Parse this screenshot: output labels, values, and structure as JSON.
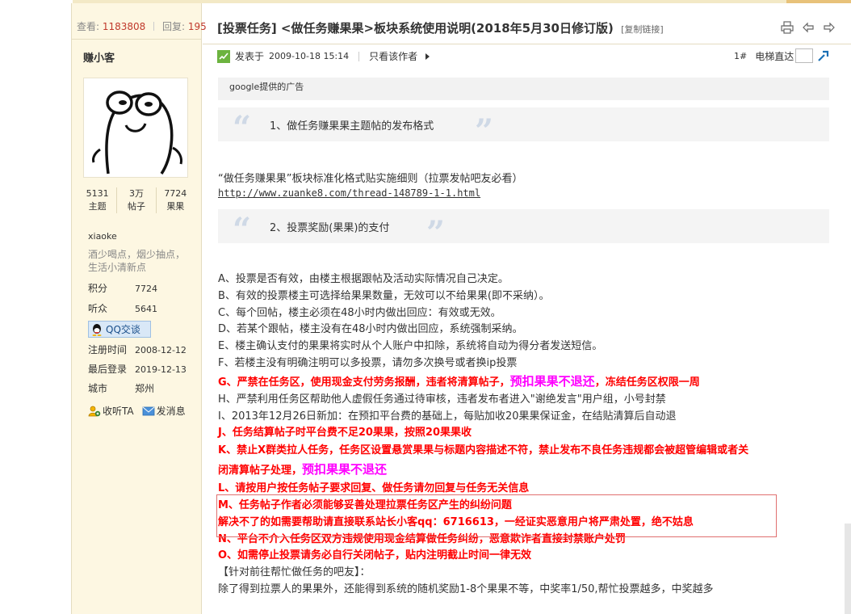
{
  "sidebar": {
    "stats_view_label": "查看:",
    "stats_view_value": "1183808",
    "stats_reply_label": "回复:",
    "stats_reply_value": "195",
    "username": "赚小客",
    "counts": [
      {
        "value": "5131",
        "label": "主题"
      },
      {
        "value": "3万",
        "label": "帖子"
      },
      {
        "value": "7724",
        "label": "果果"
      }
    ],
    "uid": "xiaoke",
    "signature": "酒少喝点，烟少抽点，生活小清新点",
    "fields": [
      {
        "label": "积分",
        "value": "7724"
      },
      {
        "label": "听众",
        "value": "5641"
      }
    ],
    "qq_button": "QQ交谈",
    "fields2": [
      {
        "label": "注册时间",
        "value": "2008-12-12"
      },
      {
        "label": "最后登录",
        "value": "2019-12-13"
      },
      {
        "label": "城市",
        "value": "郑州"
      }
    ],
    "listen_ta": "收听TA",
    "send_message": "发消息"
  },
  "post": {
    "title": "[投票任务] <做任务赚果果>板块系统使用说明(2018年5月30日修订版)",
    "copy_link": "[复制链接]",
    "posted_label": "发表于",
    "posted_time": "2009-10-18 15:14",
    "author_only": "只看该作者",
    "floor": "1#",
    "jump_label": "电梯直达",
    "ad_text": "google提供的广告",
    "quote1": "1、做任务赚果果主题帖的发布格式",
    "intro": "“做任务赚果果”板块标准化格式贴实施细则（拉票发帖吧友必看）",
    "link": "http://www.zuanke8.com/thread-148789-1-1.html",
    "quote2": "2、投票奖励(果果)的支付",
    "rule_a": "A、投票是否有效，由楼主根据跟帖及活动实际情况自己决定。",
    "rule_b": "B、有效的投票楼主可选择给果果数量，无效可以不给果果(即不采纳）。",
    "rule_c": "C、每个回帖，楼主必须在48小时内做出回应：有效或无效。",
    "rule_d": "D、若某个跟帖，楼主没有在48小时内做出回应，系统强制采纳。",
    "rule_e": "E、楼主确认支付的果果将实时从个人账户中扣除，系统将自动为得分者发送短信。",
    "rule_f": "F、若楼主没有明确注明可以多投票，请勿多次换号或者换ip投票",
    "rule_g1": "G、严禁在任务区，使用现金支付劳务报酬，违者将清算帖子，",
    "rule_g2": "预扣果果不退还",
    "rule_g3": "，冻结任务区权限一周",
    "rule_h": "H、严禁利用任务区帮助他人虚假任务通过待审核，违者发布者进入\"谢绝发言\"用户组，小号封禁",
    "rule_i": "I、2013年12月26日新加：在预扣平台费的基础上，每贴加收20果果保证金，在结贴清算后自动退",
    "rule_j": "J、任务结算帖子时平台费不足20果果，按照20果果收",
    "rule_k1": "K、禁止X群类拉人任务，任务区设置悬赏果果与标题内容描述不符，禁止发布不良任务违规都会被超管编辑或者关",
    "rule_k2": "闭清算帖子处理，",
    "rule_k3": "预扣果果不退还",
    "rule_l": "L、请按用户按任务帖子要求回复、做任务请勿回复与任务无关信息",
    "rule_m1": "M、任务帖子作者必须能够妥善处理拉票任务区产生的纠纷问题",
    "rule_m2": "解决不了的如需要帮助请直接联系站长小客qq：6716613，一经证实恶意用户将严肃处置，绝不姑息",
    "rule_n": "N、平台不介入任务区双方违规使用现金结算做任务纠纷，恶意欺诈者直接封禁账户处罚",
    "rule_o": "O、如需停止投票请务必自行关闭帖子，贴内注明截止时间一律无效",
    "helpers_heading": "【针对前往帮忙做任务的吧友】：",
    "helpers_text": "除了得到拉票人的果果外，还能得到系统的随机奖励1-8个果果不等，中奖率1/50,帮忙投票越多，中奖越多"
  },
  "colors": {
    "sidebar_bg": "#fdf7e2",
    "rule_red": "#ff0000",
    "rule_magenta": "#ff00ff",
    "stat_num": "#c0392b",
    "highlight_border": "#e07070"
  },
  "icons": [
    "print-icon",
    "prev-icon",
    "next-icon",
    "post-icon",
    "qq-icon",
    "listen-icon",
    "mail-icon",
    "jump-icon"
  ]
}
